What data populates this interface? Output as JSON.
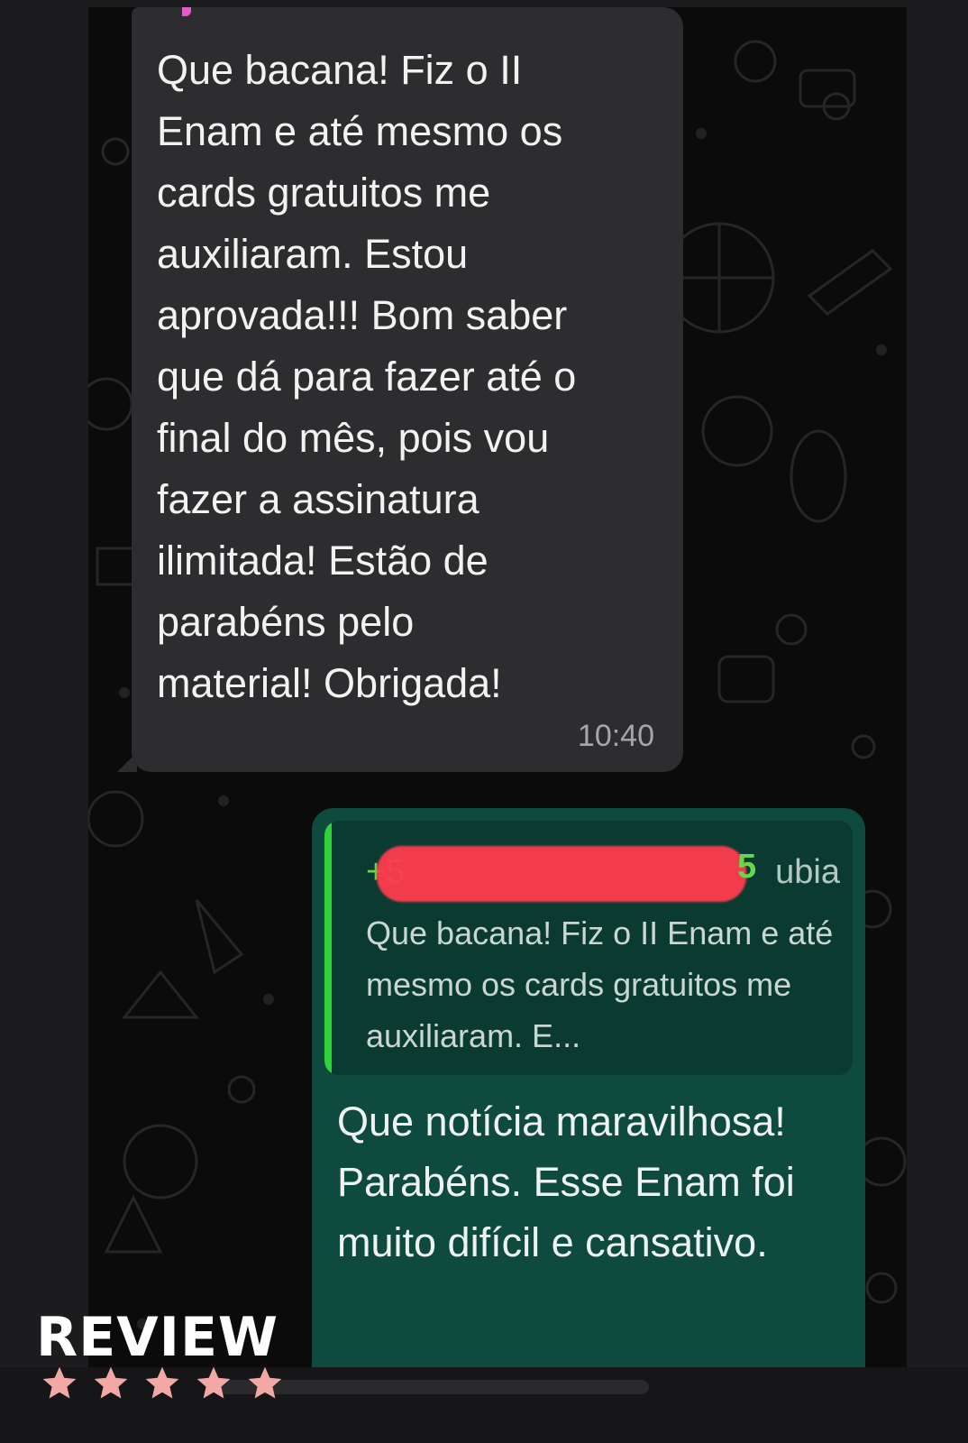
{
  "incoming_message": {
    "text": "Que bacana! Fiz o II\nEnam e até mesmo os\ncards gratuitos me\nauxiliaram. Estou\naprovada!!! Bom saber\nque dá para fazer até o\nfinal do mês, pois vou\nfazer a assinatura\nilimitada! Estão de\nparabéns pelo\nmaterial! Obrigada!",
    "time": "10:40"
  },
  "outgoing_message": {
    "quoted": {
      "author_prefix": "+5",
      "author_suffix": "5",
      "author_name_end": "ubia",
      "text": "Que bacana! Fiz o II Enam e até mesmo os cards gratuitos me auxiliaram. E..."
    },
    "text": "Que notícia maravilhosa! Parabéns. Esse Enam foi muito difícil e cansativo."
  },
  "overlay": {
    "label": "REVIEW",
    "stars": 5,
    "star_color": "#f2a9a6"
  },
  "colors": {
    "incoming_bubble": "#2d2d30",
    "outgoing_bubble": "#0e4a3d",
    "quote_bar": "#2ed33a",
    "redaction": "#ff3c4e"
  }
}
